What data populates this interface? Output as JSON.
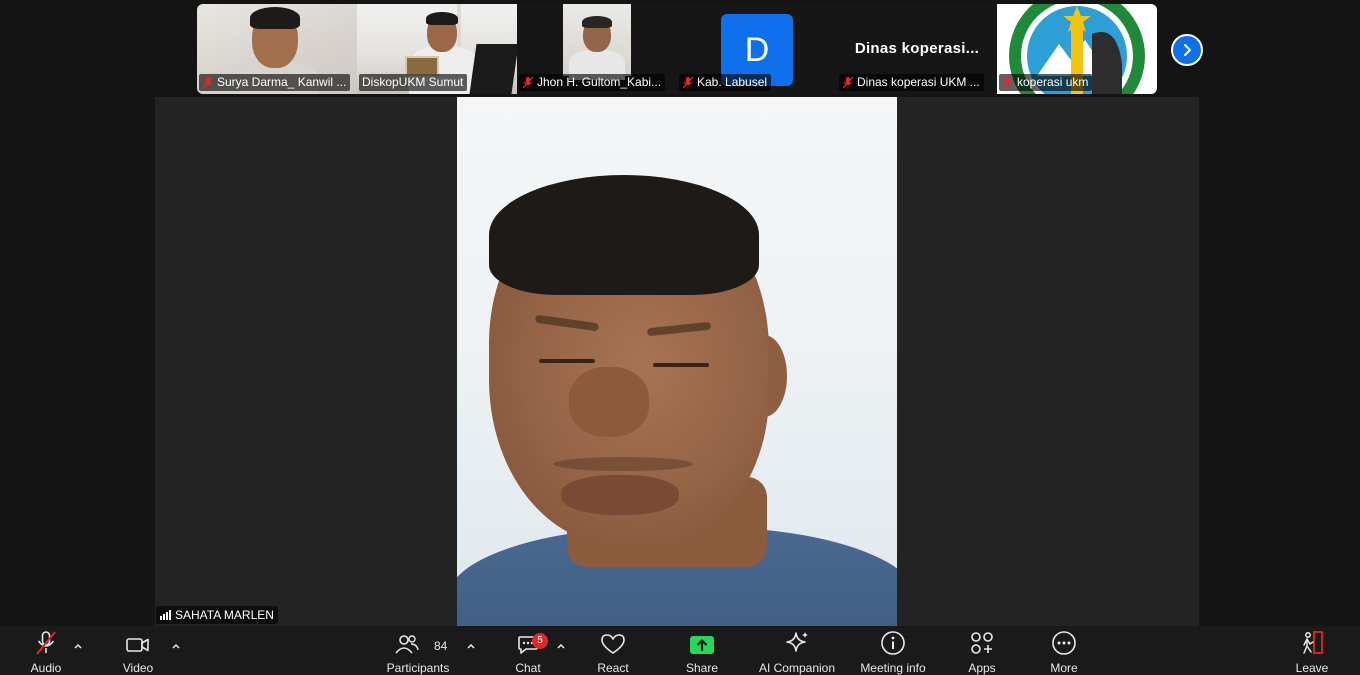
{
  "participants_strip": [
    {
      "name": "Surya Darma_ Kanwil ...",
      "type": "video"
    },
    {
      "name": "DiskopUKM Sumut",
      "type": "video"
    },
    {
      "name": "Jhon H. Gultom_Kabi...",
      "type": "video"
    },
    {
      "name": "Kab. Labusel",
      "type": "avatar",
      "avatar_letter": "D"
    },
    {
      "name": "Dinas koperasi UKM ...",
      "type": "name",
      "display_name": "Dinas  koperasi..."
    },
    {
      "name": "koperasi ukm",
      "type": "logo"
    }
  ],
  "active_speaker": {
    "name": "SAHATA MARLEN"
  },
  "toolbar": {
    "audio": "Audio",
    "video": "Video",
    "participants": "Participants",
    "participants_count": "84",
    "chat": "Chat",
    "chat_badge": "5",
    "react": "React",
    "share": "Share",
    "ai_companion": "AI Companion",
    "meeting_info": "Meeting info",
    "apps": "Apps",
    "more": "More",
    "leave": "Leave"
  },
  "colors": {
    "accent": "#0e71eb",
    "mute_red": "#e02828",
    "share_green": "#23d959",
    "leave_red": "#e02828"
  }
}
